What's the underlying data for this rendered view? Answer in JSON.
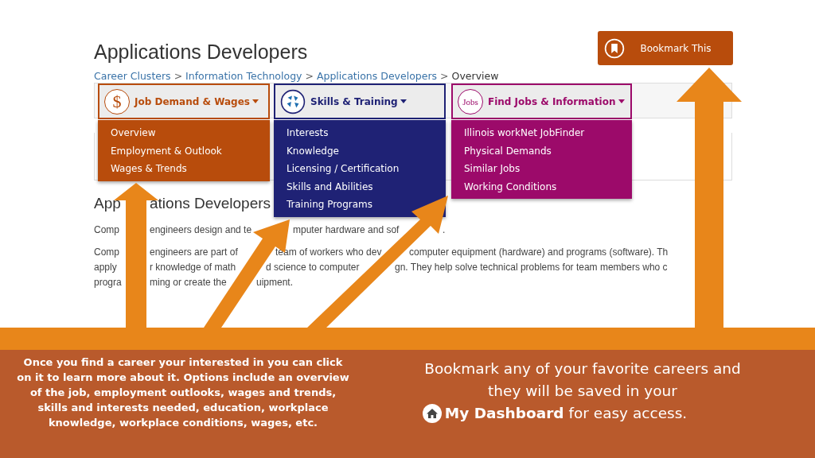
{
  "page": {
    "title": "Applications Developers",
    "bookmark_button": "Bookmark This",
    "breadcrumb": {
      "separator": ">",
      "items": [
        {
          "label": "Career Clusters",
          "link": true
        },
        {
          "label": "Information Technology",
          "link": true
        },
        {
          "label": "Applications Developers",
          "link": true
        },
        {
          "label": "Overview",
          "link": false
        }
      ]
    }
  },
  "menus": [
    {
      "label": "Job Demand & Wages",
      "kind": "dollar",
      "badge": "$",
      "color": "#b84c0c",
      "items": [
        "Overview",
        "Employment & Outlook",
        "Wages & Trends"
      ]
    },
    {
      "label": "Skills & Training",
      "kind": "skills",
      "color": "#1f2275",
      "items": [
        "Interests",
        "Knowledge",
        "Licensing / Certification",
        "Skills and Abilities",
        "Training Programs"
      ]
    },
    {
      "label": "Find Jobs & Information",
      "kind": "jobs",
      "badge": "Jobs",
      "color": "#9c0a6a",
      "items": [
        "Illinois workNet JobFinder",
        "Physical Demands",
        "Similar Jobs",
        "Working Conditions"
      ]
    }
  ],
  "section": {
    "heading": [
      "App",
      "ations Developers"
    ],
    "paragraphs": [
      [
        [
          "Comp",
          "engineers design and te",
          "mputer hardware and sof",
          "."
        ]
      ],
      [
        [
          "Comp",
          "engineers are part of",
          "team of workers who dev",
          "computer equipment (hardware) and programs (software). Th"
        ],
        [
          "apply",
          "r knowledge of math",
          "d science to computer",
          "gn. They help solve technical problems for team members who c"
        ],
        [
          "progra",
          "ming or create the",
          "uipment."
        ]
      ]
    ]
  },
  "caption": {
    "left": "Once you find a career your interested in you can click on it to learn more about it. Options include an overview of the job, employment outlooks, wages and trends, skills and interests needed, education, workplace knowledge, workplace conditions, wages, etc.",
    "right": "Bookmark any of your favorite careers and they will be saved in your",
    "right_link": "**My Dashboard** for easy access."
  }
}
